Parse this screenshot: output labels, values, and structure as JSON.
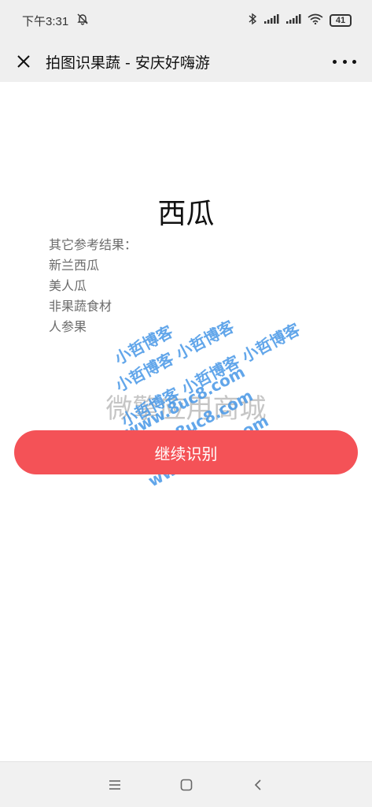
{
  "status_bar": {
    "time": "下午3:31",
    "battery": "41"
  },
  "header": {
    "title": "拍图识果蔬 - 安庆好嗨游"
  },
  "result": {
    "title": "西瓜",
    "alt_heading": "其它参考结果：",
    "alternatives": [
      "新兰西瓜",
      "美人瓜",
      "非果蔬食材",
      "人参果"
    ]
  },
  "actions": {
    "continue_label": "继续识别"
  },
  "watermarks": {
    "store": "微擎应用商城",
    "blog_1": "小哲博客",
    "blog_2": "小哲博客 小哲博客",
    "blog_3": "小哲博客 小哲博客 小哲博客",
    "site_1": "www.8uc8.com",
    "site_2": "www.8uc8.com",
    "site_3": "www.8uc8.com"
  },
  "colors": {
    "accent": "#f45257",
    "bar_bg": "#efefef"
  }
}
